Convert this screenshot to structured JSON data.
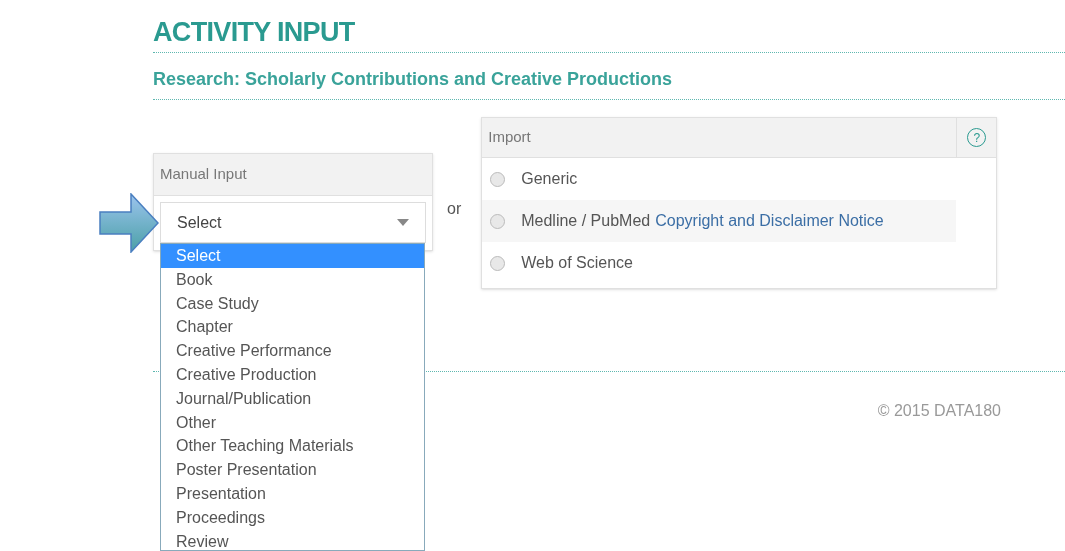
{
  "title": "ACTIVITY INPUT",
  "subtitle": "Research: Scholarly Contributions and Creative Productions",
  "manual_input": {
    "header": "Manual Input",
    "select": {
      "value": "Select",
      "expanded": true
    },
    "options": [
      {
        "label": "Select",
        "selected": true
      },
      {
        "label": "Book",
        "selected": false
      },
      {
        "label": "Case Study",
        "selected": false
      },
      {
        "label": "Chapter",
        "selected": false
      },
      {
        "label": "Creative Performance",
        "selected": false
      },
      {
        "label": "Creative Production",
        "selected": false
      },
      {
        "label": "Journal/Publication",
        "selected": false
      },
      {
        "label": "Other",
        "selected": false
      },
      {
        "label": "Other Teaching Materials",
        "selected": false
      },
      {
        "label": "Poster Presentation",
        "selected": false
      },
      {
        "label": "Presentation",
        "selected": false
      },
      {
        "label": "Proceedings",
        "selected": false
      },
      {
        "label": "Review",
        "selected": false
      }
    ]
  },
  "separator": "or",
  "import": {
    "header": "Import",
    "help_icon": "?",
    "options": [
      {
        "label": "Generic",
        "checked": false,
        "highlighted": false
      },
      {
        "label": "Medline / PubMed",
        "link": "Copyright and Disclaimer Notice",
        "checked": false,
        "highlighted": true
      },
      {
        "label": "Web of Science",
        "checked": false,
        "highlighted": false
      }
    ]
  },
  "footer": "© 2015 DATA180"
}
